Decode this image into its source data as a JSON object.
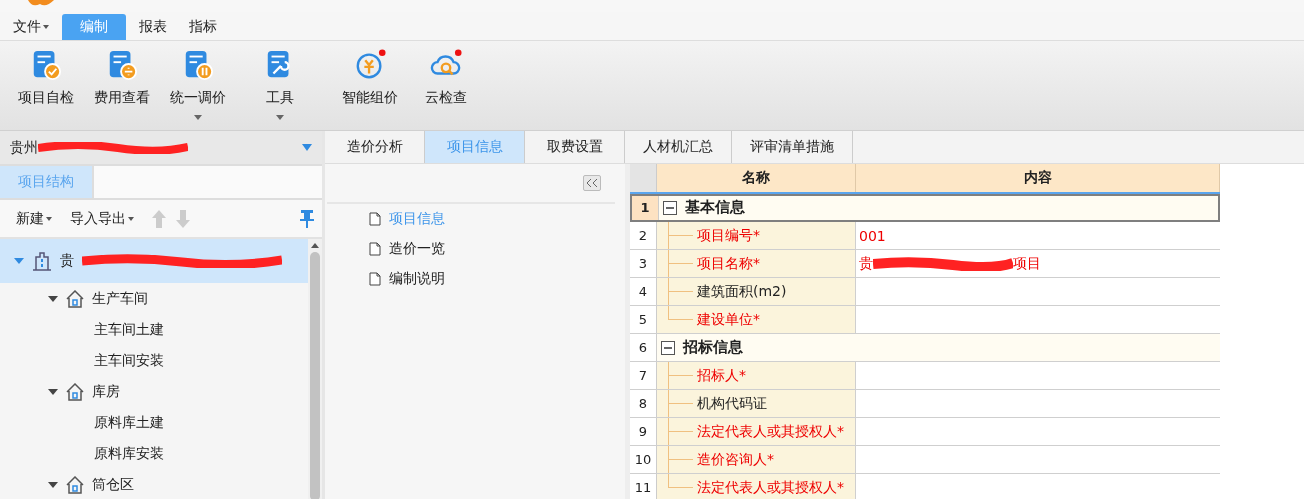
{
  "menu": [
    {
      "label": "文件",
      "selected": false,
      "dropdown": true
    },
    {
      "label": "编制",
      "selected": true,
      "dropdown": false
    },
    {
      "label": "报表",
      "selected": false,
      "dropdown": false
    },
    {
      "label": "指标",
      "selected": false,
      "dropdown": false
    }
  ],
  "ribbon": [
    {
      "label": "项目自检",
      "dropdown": false,
      "badge": false
    },
    {
      "label": "费用查看",
      "dropdown": false,
      "badge": false
    },
    {
      "label": "统一调价",
      "dropdown": true,
      "badge": false
    },
    {
      "label": "工具",
      "dropdown": true,
      "badge": false
    },
    {
      "label": "智能组价",
      "dropdown": false,
      "badge": true
    },
    {
      "label": "云检查",
      "dropdown": false,
      "badge": true
    }
  ],
  "project_select": {
    "value": "贵州",
    "redacted": true
  },
  "side_tabs": [
    {
      "label": "项目结构",
      "selected": true
    }
  ],
  "side_toolbar": [
    {
      "label": "新建",
      "dropdown": true
    },
    {
      "label": "导入导出",
      "dropdown": true
    }
  ],
  "tree": [
    {
      "label": "贵",
      "kind": "project",
      "expanded": true,
      "selected": true,
      "redacted": true,
      "children": [
        {
          "label": "生产车间",
          "kind": "unit",
          "expanded": true,
          "selected": false,
          "children": [
            {
              "label": "主车间土建",
              "kind": "item",
              "selected": false
            },
            {
              "label": "主车间安装",
              "kind": "item",
              "selected": false
            }
          ]
        },
        {
          "label": "库房",
          "kind": "unit",
          "expanded": true,
          "selected": false,
          "children": [
            {
              "label": "原料库土建",
              "kind": "item",
              "selected": false
            },
            {
              "label": "原料库安装",
              "kind": "item",
              "selected": false
            }
          ]
        },
        {
          "label": "筒仓区",
          "kind": "unit",
          "expanded": true,
          "selected": false
        }
      ]
    }
  ],
  "main_tabs": [
    {
      "label": "造价分析",
      "selected": false
    },
    {
      "label": "项目信息",
      "selected": true
    },
    {
      "label": "取费设置",
      "selected": false
    },
    {
      "label": "人材机汇总",
      "selected": false
    },
    {
      "label": "评审清单措施",
      "selected": false
    }
  ],
  "nav_items": [
    {
      "label": "项目信息",
      "selected": true
    },
    {
      "label": "造价一览",
      "selected": false
    },
    {
      "label": "编制说明",
      "selected": false
    }
  ],
  "grid": {
    "columns": [
      "名称",
      "内容"
    ],
    "rows": [
      {
        "num": "1",
        "kind": "group",
        "name": "基本信息",
        "expanded": true,
        "selected": true
      },
      {
        "num": "2",
        "kind": "field",
        "name": "项目编号*",
        "required": true,
        "value": "001"
      },
      {
        "num": "3",
        "kind": "field",
        "name": "项目名称*",
        "required": true,
        "value": "贵",
        "redacted": true,
        "value_end": "项目"
      },
      {
        "num": "4",
        "kind": "field",
        "name": "建筑面积(m2)",
        "required": false
      },
      {
        "num": "5",
        "kind": "field",
        "name": "建设单位*",
        "required": true
      },
      {
        "num": "6",
        "kind": "group",
        "name": "招标信息",
        "expanded": true,
        "selected": false
      },
      {
        "num": "7",
        "kind": "field",
        "name": "招标人*",
        "required": true
      },
      {
        "num": "8",
        "kind": "field",
        "name": "机构代码证",
        "required": false
      },
      {
        "num": "9",
        "kind": "field",
        "name": "法定代表人或其授权人*",
        "required": true
      },
      {
        "num": "10",
        "kind": "field",
        "name": "造价咨询人*",
        "required": true
      },
      {
        "num": "11",
        "kind": "field",
        "name": "法定代表人或其授权人*",
        "required": true
      }
    ]
  }
}
